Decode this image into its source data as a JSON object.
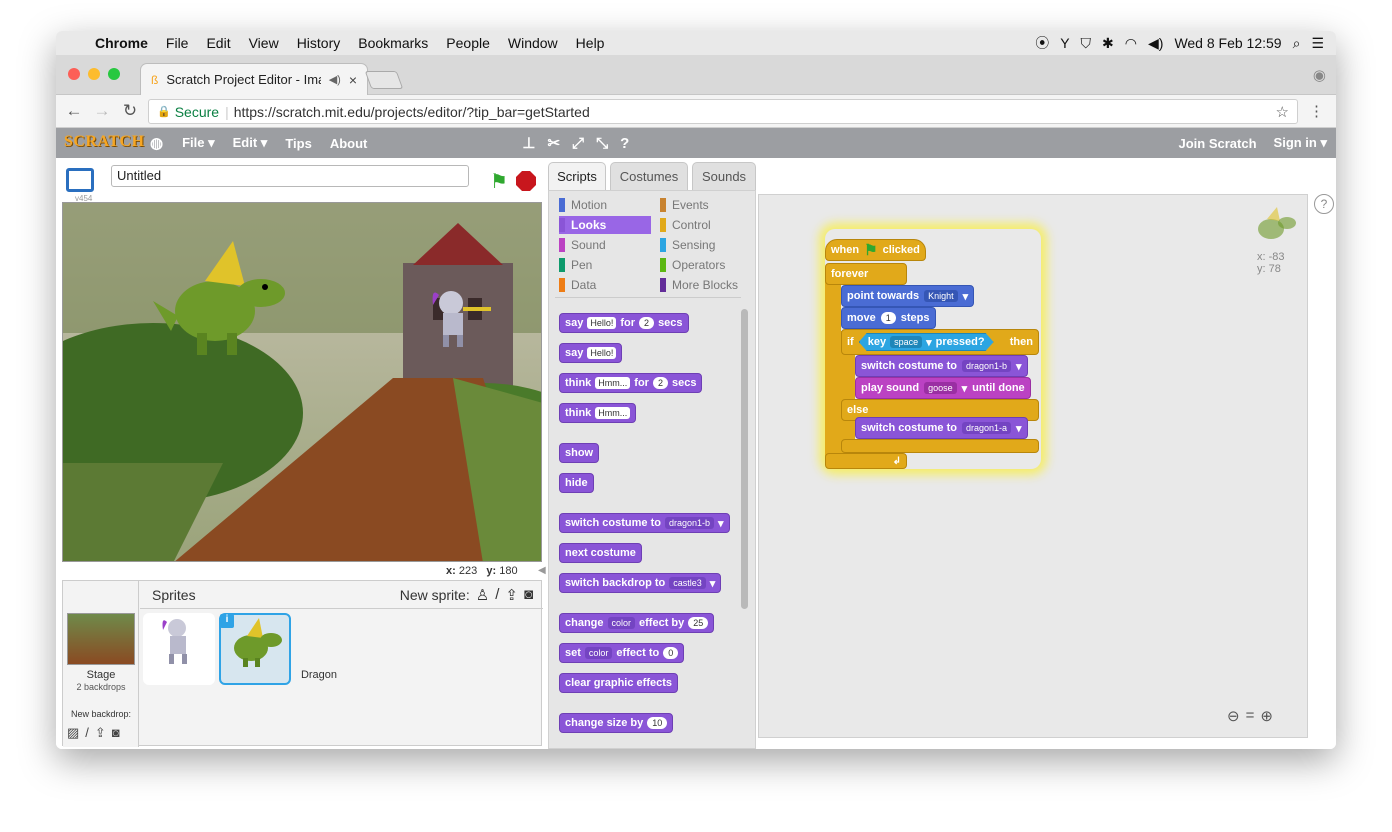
{
  "os": {
    "menu": [
      "Chrome",
      "File",
      "Edit",
      "View",
      "History",
      "Bookmarks",
      "People",
      "Window",
      "Help"
    ],
    "clock": "Wed 8 Feb  12:59"
  },
  "browser": {
    "tab_title": "Scratch Project Editor - Ima",
    "secure_label": "Secure",
    "url": "https://scratch.mit.edu/projects/editor/?tip_bar=getStarted"
  },
  "scratch": {
    "logo": "SCRATCH",
    "menu": [
      "File ▾",
      "Edit ▾",
      "Tips",
      "About"
    ],
    "join": "Join Scratch",
    "signin": "Sign in ▾"
  },
  "stage": {
    "version": "v454",
    "project_title": "Untitled",
    "coord_x_label": "x:",
    "coord_x": "223",
    "coord_y_label": "y:",
    "coord_y": "180"
  },
  "sprites": {
    "header": "Sprites",
    "new_sprite": "New sprite:",
    "stage_label": "Stage",
    "stage_sub": "2 backdrops",
    "new_backdrop": "New backdrop:",
    "items": [
      "Knight",
      "Dragon"
    ]
  },
  "tabs": [
    "Scripts",
    "Costumes",
    "Sounds"
  ],
  "categories": {
    "left": [
      "Motion",
      "Looks",
      "Sound",
      "Pen",
      "Data"
    ],
    "right": [
      "Events",
      "Control",
      "Sensing",
      "Operators",
      "More Blocks"
    ],
    "colors": {
      "Motion": "#4a6cd4",
      "Looks": "#8a55d7",
      "Sound": "#bb42c3",
      "Pen": "#0e9a6c",
      "Data": "#ee7d16",
      "Events": "#c88330",
      "Control": "#e1a91a",
      "Sensing": "#2ca5e2",
      "Operators": "#5cb712",
      "More Blocks": "#632d99"
    }
  },
  "palette": {
    "say_for": [
      "say",
      "Hello!",
      "for",
      "2",
      "secs"
    ],
    "say": [
      "say",
      "Hello!"
    ],
    "think_for": [
      "think",
      "Hmm...",
      "for",
      "2",
      "secs"
    ],
    "think": [
      "think",
      "Hmm..."
    ],
    "show": "show",
    "hide": "hide",
    "switch_costume": [
      "switch costume to",
      "dragon1-b"
    ],
    "next_costume": "next costume",
    "switch_backdrop": [
      "switch backdrop to",
      "castle3"
    ],
    "change_effect": [
      "change",
      "color",
      "effect by",
      "25"
    ],
    "set_effect": [
      "set",
      "color",
      "effect to",
      "0"
    ],
    "clear_effects": "clear graphic effects",
    "change_size": [
      "change size by",
      "10"
    ]
  },
  "script": {
    "hat": [
      "when",
      "clicked"
    ],
    "forever": "forever",
    "point": [
      "point towards",
      "Knight"
    ],
    "move": [
      "move",
      "1",
      "steps"
    ],
    "if": "if",
    "key": [
      "key",
      "space",
      "pressed?"
    ],
    "then": "then",
    "switch1": [
      "switch costume to",
      "dragon1-b"
    ],
    "play": [
      "play sound",
      "goose",
      "until done"
    ],
    "else": "else",
    "switch2": [
      "switch costume to",
      "dragon1-a"
    ]
  },
  "sprite_info": {
    "x": "x: -83",
    "y": "y: 78"
  }
}
